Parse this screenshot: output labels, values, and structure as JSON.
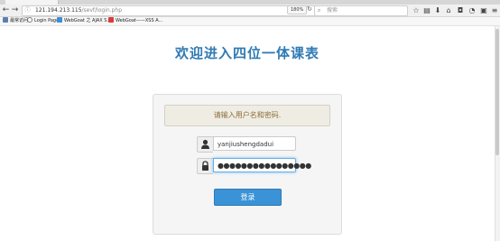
{
  "browser": {
    "url_host": "121.194.213.115",
    "url_path": "/sevf/login.php",
    "zoom": "180%",
    "search_placeholder": "搜索"
  },
  "bookmarks": [
    {
      "label": "最常访问",
      "color": "#5b7fb0"
    },
    {
      "label": "Login Page",
      "color": "#7a7a7a"
    },
    {
      "label": "WebGoat 之 AJAX S...",
      "color": "#3c8dd8"
    },
    {
      "label": "WebGoat——XSS A...",
      "color": "#d83c3c"
    }
  ],
  "page": {
    "title": "欢迎进入四位一体课表",
    "alert": "请输入用户名和密码.",
    "username": "yanjiushengdadui",
    "password_mask": "●●●●●●●●●●●●●●●●",
    "login_label": "登录"
  },
  "colors": {
    "title": "#2f7ab4",
    "button": "#3a93d6",
    "alert_bg": "#efece3"
  }
}
